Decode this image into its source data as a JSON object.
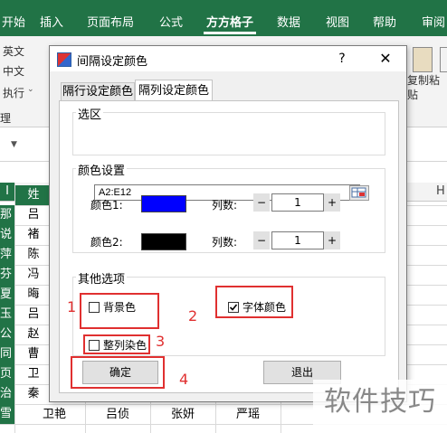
{
  "ribbon": {
    "tabs": [
      "开始",
      "插入",
      "页面布局",
      "公式",
      "方方格子",
      "数据",
      "视图",
      "帮助",
      "审阅"
    ],
    "active_tab": "方方格子",
    "left_items": [
      "英文",
      "中文",
      "执行",
      "理"
    ],
    "right_items": [
      "复制粘",
      "贴"
    ],
    "header_letter": "H"
  },
  "sheet": {
    "first_col_header": "I",
    "row_labels": [
      "那",
      "说",
      "萍",
      "芬",
      "夏",
      "玉",
      "公",
      "同",
      "页",
      "治",
      "雪"
    ],
    "col_b_values": [
      "姓",
      "吕",
      "褚",
      "陈",
      "冯",
      "晦",
      "吕",
      "赵",
      "曹",
      "卫",
      "秦"
    ],
    "last_row": [
      "卫艳",
      "吕侦",
      "张妍",
      "严瑶"
    ]
  },
  "dialog": {
    "title": "间隔设定颜色",
    "help": "?",
    "close": "✕",
    "tabs": [
      "隔行设定颜色",
      "隔列设定颜色"
    ],
    "active_tab": "隔列设定颜色",
    "range_group": {
      "title": "选区",
      "value": "A2:E12"
    },
    "color_group": {
      "title": "颜色设置",
      "color1_label": "颜色1:",
      "color2_label": "颜色2:",
      "color1": "#0000ff",
      "color2": "#000000",
      "cols_label": "列数:",
      "minus": "−",
      "plus": "+",
      "color1_cols": "1",
      "color2_cols": "1"
    },
    "other_group": {
      "title": "其他选项",
      "background_color": {
        "label": "背景色",
        "checked": false
      },
      "font_color": {
        "label": "字体颜色",
        "checked": true
      },
      "whole_column": {
        "label": "整列染色",
        "checked": false
      }
    },
    "ok_label": "确定",
    "exit_label": "退出"
  },
  "annotations": [
    "1",
    "2",
    "3",
    "4"
  ],
  "watermark": "软件技巧",
  "colors": {
    "excel_green": "#217346",
    "annotation_red": "#e03030"
  }
}
